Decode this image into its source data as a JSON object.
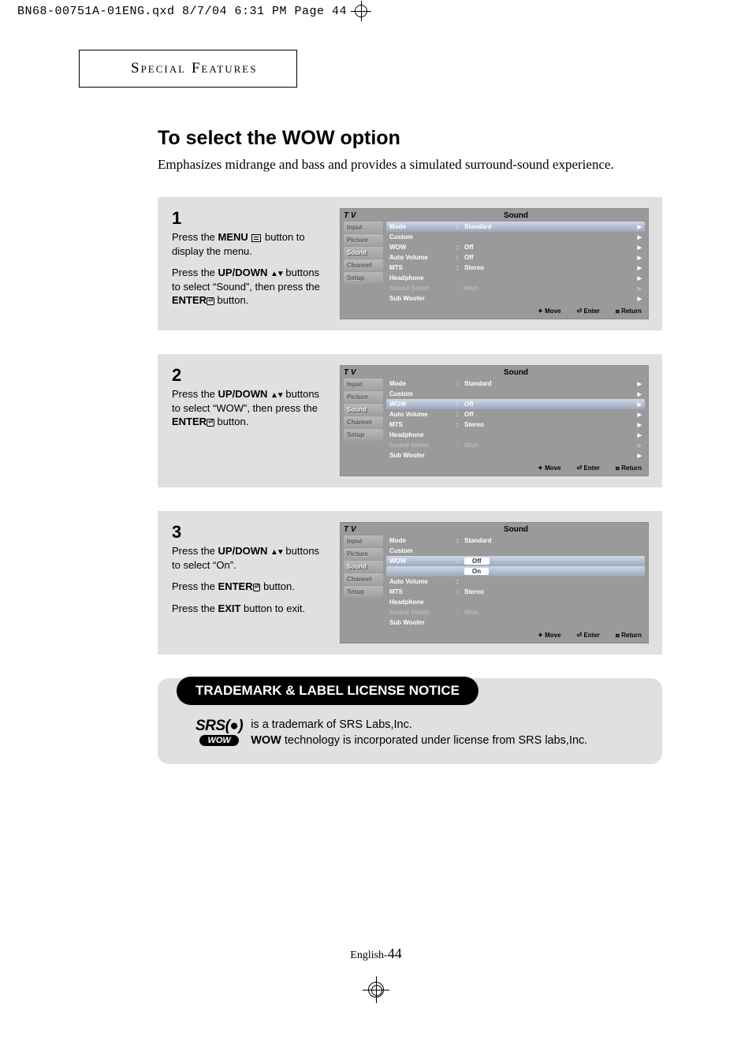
{
  "slug": "BN68-00751A-01ENG.qxd  8/7/04 6:31 PM  Page 44",
  "section_tab": "Special Features",
  "title": "To select the WOW option",
  "intro": "Emphasizes midrange and bass and provides a simulated surround-sound experience.",
  "steps": [
    {
      "num": "1",
      "paras": [
        [
          {
            "t": "Press the "
          },
          {
            "t": "MENU",
            "b": true
          },
          {
            "t": " "
          },
          {
            "icon": "menu"
          },
          {
            "t": " button to display the menu."
          }
        ],
        [
          {
            "t": "Press the "
          },
          {
            "t": "UP/DOWN",
            "b": true
          },
          {
            "t": " "
          },
          {
            "icon": "updown"
          },
          {
            "t": " buttons to select “Sound”, then press the "
          },
          {
            "t": "ENTER",
            "b": true
          },
          {
            "icon": "enter"
          },
          {
            "t": " button."
          }
        ]
      ],
      "osd": {
        "tv": "T V",
        "title": "Sound",
        "side": [
          "Input",
          "Picture",
          "Sound",
          "Channel",
          "Setup"
        ],
        "side_sel": 2,
        "rows": [
          {
            "k": "Mode",
            "c": ":",
            "v": "Standard",
            "hl": true,
            "arrow": "▶"
          },
          {
            "k": "Custom",
            "c": "",
            "v": "",
            "arrow": "▶"
          },
          {
            "k": "WOW",
            "c": ":",
            "v": "Off",
            "arrow": "▶"
          },
          {
            "k": "Auto Volume",
            "c": ":",
            "v": "Off",
            "arrow": "▶"
          },
          {
            "k": "MTS",
            "c": ":",
            "v": "Stereo",
            "arrow": "▶"
          },
          {
            "k": "Headphone",
            "c": "",
            "v": "",
            "arrow": "▶"
          },
          {
            "k": "Sound Select",
            "c": ":",
            "v": "Main",
            "dim": true,
            "arrow": "▶"
          },
          {
            "k": "Sub Woofer",
            "c": "",
            "v": "",
            "arrow": "▶"
          }
        ],
        "foot": [
          "✦ Move",
          "⏎ Enter",
          "⧈ Return"
        ]
      }
    },
    {
      "num": "2",
      "paras": [
        [
          {
            "t": "Press the "
          },
          {
            "t": "UP/DOWN",
            "b": true
          },
          {
            "t": " "
          },
          {
            "icon": "updown"
          },
          {
            "t": " buttons to select “WOW”, then press the "
          },
          {
            "t": "ENTER",
            "b": true
          },
          {
            "icon": "enter"
          },
          {
            "t": " button."
          }
        ]
      ],
      "osd": {
        "tv": "T V",
        "title": "Sound",
        "side": [
          "Input",
          "Picture",
          "Sound",
          "Channel",
          "Setup"
        ],
        "side_sel": 2,
        "rows": [
          {
            "k": "Mode",
            "c": ":",
            "v": "Standard",
            "arrow": "▶"
          },
          {
            "k": "Custom",
            "c": "",
            "v": "",
            "arrow": "▶"
          },
          {
            "k": "WOW",
            "c": ":",
            "v": "Off",
            "hl": true,
            "arrow": "▶"
          },
          {
            "k": "Auto Volume",
            "c": ":",
            "v": "Off",
            "arrow": "▶"
          },
          {
            "k": "MTS",
            "c": ":",
            "v": "Stereo",
            "arrow": "▶"
          },
          {
            "k": "Headphone",
            "c": "",
            "v": "",
            "arrow": "▶"
          },
          {
            "k": "Sound Select",
            "c": ":",
            "v": "Main",
            "dim": true,
            "arrow": "▶"
          },
          {
            "k": "Sub Woofer",
            "c": "",
            "v": "",
            "arrow": "▶"
          }
        ],
        "foot": [
          "✦ Move",
          "⏎ Enter",
          "⧈ Return"
        ]
      }
    },
    {
      "num": "3",
      "paras": [
        [
          {
            "t": "Press the "
          },
          {
            "t": "UP/DOWN",
            "b": true
          },
          {
            "t": " "
          },
          {
            "icon": "updown"
          },
          {
            "t": " buttons to select “On”."
          }
        ],
        [
          {
            "t": "Press the "
          },
          {
            "t": "ENTER",
            "b": true
          },
          {
            "icon": "enter"
          },
          {
            "t": " button."
          }
        ],
        [
          {
            "t": "Press the "
          },
          {
            "t": "EXIT",
            "b": true
          },
          {
            "t": " button to exit."
          }
        ]
      ],
      "osd": {
        "tv": "T V",
        "title": "Sound",
        "side": [
          "Input",
          "Picture",
          "Sound",
          "Channel",
          "Setup"
        ],
        "side_sel": 2,
        "rows": [
          {
            "k": "Mode",
            "c": ":",
            "v": "Standard",
            "arrow": ""
          },
          {
            "k": "Custom",
            "c": "",
            "v": "",
            "arrow": ""
          },
          {
            "k": "WOW",
            "c": ":",
            "v": "Off",
            "hl": true,
            "box": true,
            "arrow": ""
          },
          {
            "k": "",
            "c": "",
            "v": "On",
            "hl": true,
            "box": true,
            "arrow": ""
          },
          {
            "k": "Auto Volume",
            "c": ":",
            "v": "",
            "dimv": true,
            "arrow": ""
          },
          {
            "k": "MTS",
            "c": ":",
            "v": "Stereo",
            "arrow": ""
          },
          {
            "k": "Headphone",
            "c": "",
            "v": "",
            "arrow": ""
          },
          {
            "k": "Sound Select",
            "c": ":",
            "v": "Main",
            "dim": true,
            "arrow": ""
          },
          {
            "k": "Sub Woofer",
            "c": "",
            "v": "",
            "arrow": ""
          }
        ],
        "foot": [
          "✦ Move",
          "⏎ Enter",
          "⧈ Return"
        ]
      }
    }
  ],
  "notice": {
    "head": "TRADEMARK & LABEL LICENSE NOTICE",
    "srs_top": "SRS(●)",
    "srs_bot": "WOW",
    "line1": "is a trademark of SRS Labs,Inc.",
    "line2_bold": "WOW",
    "line2_rest": " technology is incorporated under license from SRS labs,Inc."
  },
  "footer": {
    "lang": "English-",
    "page": "44"
  }
}
